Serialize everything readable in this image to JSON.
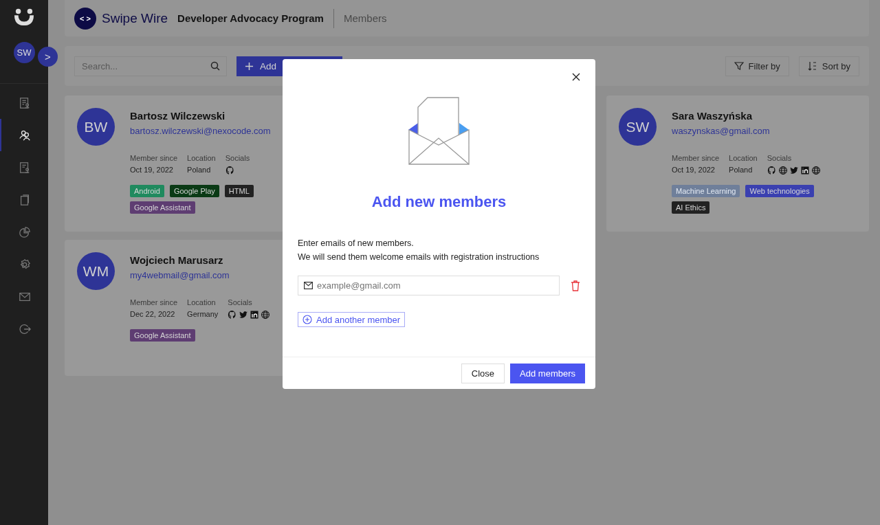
{
  "sidebar": {
    "avatar": "SW",
    "expand_icon": ">",
    "items": [
      {
        "kind": "report",
        "selected": false
      },
      {
        "kind": "members",
        "selected": true
      },
      {
        "kind": "certificate",
        "selected": false
      },
      {
        "kind": "documents",
        "selected": false
      },
      {
        "kind": "chart",
        "selected": false
      },
      {
        "kind": "settings",
        "selected": false
      },
      {
        "kind": "mail",
        "selected": false
      },
      {
        "kind": "logout",
        "selected": false
      }
    ]
  },
  "header": {
    "logo_mark": "< >",
    "logo_text": "Swipe Wire",
    "program": "Developer Advocacy Program",
    "section": "Members"
  },
  "toolbar": {
    "search": {
      "placeholder": "Search..."
    },
    "add_button": "Add",
    "filter_button": "Filter by",
    "sort_button": "Sort by"
  },
  "members": [
    {
      "initials": "BW",
      "name": "Bartosz Wilczewski",
      "email": "bartosz.wilczewski@nexocode.com",
      "since_label": "Member since",
      "since": "Oct 19, 2022",
      "location_label": "Location",
      "location": "Poland",
      "socials_label": "Socials",
      "socials": [
        {
          "kind": "github"
        }
      ],
      "tags": [
        {
          "label": "Android",
          "color": "#1f8a5e"
        },
        {
          "label": "Google Play",
          "color": "#0a3a15"
        },
        {
          "label": "HTML",
          "color": "#222222"
        },
        {
          "label": "Google Assistant",
          "color": "#5e3d72"
        }
      ]
    },
    {
      "initials": "SW",
      "name": "Sara Waszyńska",
      "email": "waszynskas@gmail.com",
      "since_label": "Member since",
      "since": "Oct 19, 2022",
      "location_label": "Location",
      "location": "Poland",
      "socials_label": "Socials",
      "socials": [
        {
          "kind": "github"
        },
        {
          "kind": "globe"
        },
        {
          "kind": "twitter"
        },
        {
          "kind": "linkedin"
        },
        {
          "kind": "globe"
        }
      ],
      "tags": [
        {
          "label": "Machine Learning",
          "color": "#6f7f9a"
        },
        {
          "label": "Web technologies",
          "color": "#3a40b0"
        },
        {
          "label": "AI Ethics",
          "color": "#222222"
        }
      ]
    },
    {
      "initials": "WM",
      "name": "Wojciech Marusarz",
      "email": "my4webmail@gmail.com",
      "since_label": "Member since",
      "since": "Dec 22, 2022",
      "location_label": "Location",
      "location": "Germany",
      "socials_label": "Socials",
      "socials": [
        {
          "kind": "github"
        },
        {
          "kind": "twitter"
        },
        {
          "kind": "linkedin"
        },
        {
          "kind": "globe"
        }
      ],
      "tags": [
        {
          "label": "Google Assistant",
          "color": "#5e3d72"
        }
      ]
    }
  ],
  "modal": {
    "title": "Add new members",
    "text_lines": [
      "Enter emails of new members.",
      "We will send them welcome emails with registration instructions"
    ],
    "email_fields": [
      {
        "placeholder": "example@gmail.com"
      }
    ],
    "add_another": "Add another member",
    "close_button": "Close",
    "submit_button": "Add members"
  }
}
